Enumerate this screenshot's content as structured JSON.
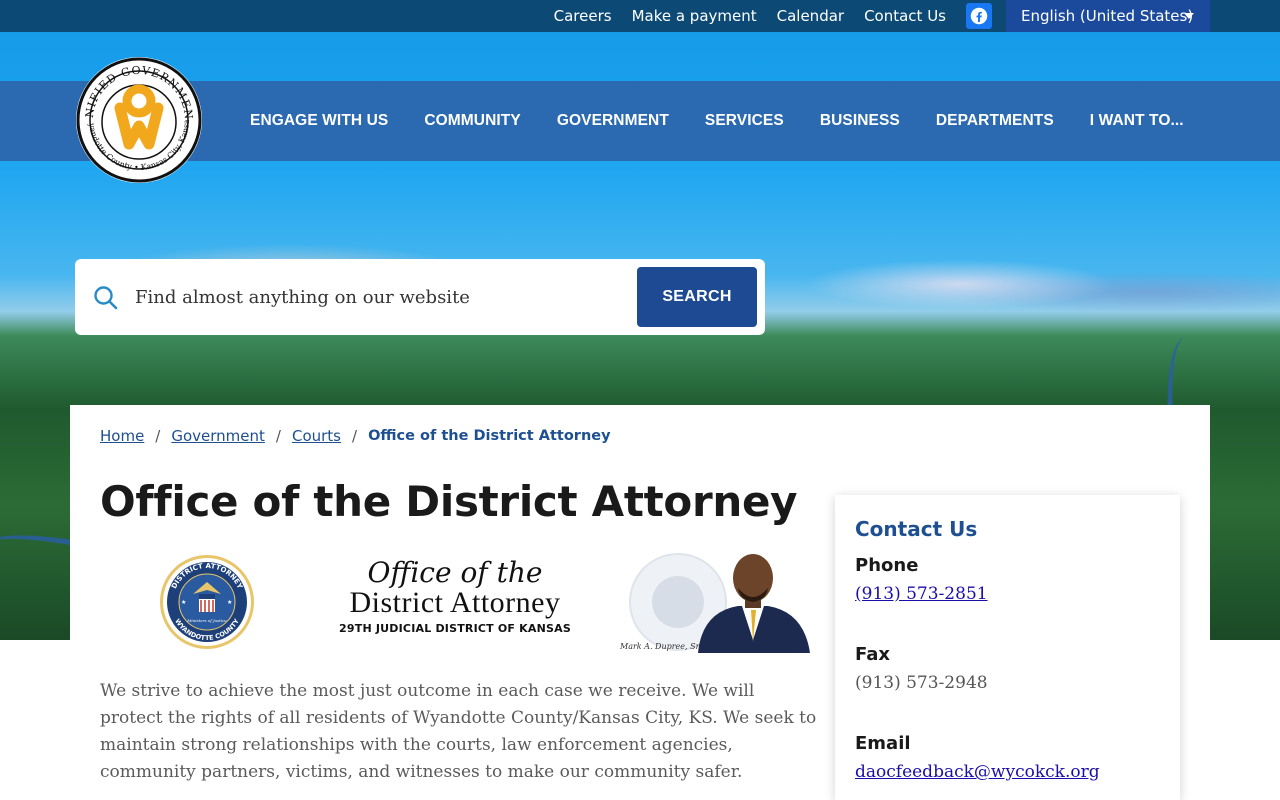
{
  "topbar": {
    "links": [
      "Careers",
      "Make a payment",
      "Calendar",
      "Contact Us"
    ],
    "facebook_icon": "facebook-icon",
    "language": "English (United States)"
  },
  "logo": {
    "top_text": "UNIFIED GOVERNMENT",
    "bottom_text": "Wyandotte County • Kansas City, Kansas"
  },
  "nav": {
    "items": [
      "ENGAGE WITH US",
      "COMMUNITY",
      "GOVERNMENT",
      "SERVICES",
      "BUSINESS",
      "DEPARTMENTS",
      "I WANT TO..."
    ]
  },
  "search": {
    "placeholder": "Find almost anything on our website",
    "button_label": "SEARCH"
  },
  "breadcrumb": {
    "items": [
      "Home",
      "Government",
      "Courts"
    ],
    "current": "Office of the District Attorney"
  },
  "page": {
    "title": "Office of the District Attorney",
    "banner": {
      "line1": "Office of the",
      "line2": "District Attorney",
      "line3": "29TH JUDICIAL DISTRICT OF KANSAS",
      "seal_top": "DISTRICT ATTORNEY",
      "seal_bottom": "WYANDOTTE COUNTY",
      "seal_motto": "Ministers of Justice",
      "portrait_caption": "Mark A. Dupree, Sr."
    },
    "description": "We strive to achieve the most just outcome in each case we receive. We will protect the rights of all residents of Wyandotte County/Kansas City, KS. We seek to maintain strong relationships with the courts, law enforcement agencies, community partners, victims, and witnesses to make our community safer."
  },
  "contact": {
    "title": "Contact Us",
    "phone_label": "Phone",
    "phone": "(913) 573-2851",
    "fax_label": "Fax",
    "fax": "(913) 573-2948",
    "email_label": "Email",
    "email": "daocfeedback@wycokck.org"
  },
  "colors": {
    "topbar": "#0c4a75",
    "nav": "#2d65aa",
    "accent": "#1d4f91",
    "button": "#1d4a92",
    "logo_gold": "#f2a81d"
  }
}
